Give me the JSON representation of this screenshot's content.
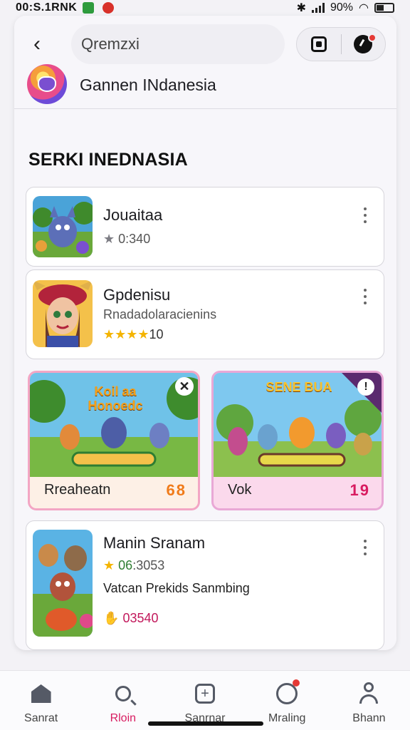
{
  "status_bar": {
    "time": "00:S.1RNK",
    "battery": "90%"
  },
  "header": {
    "search_text": "Qremzxi",
    "channel_name": "Gannen INdanesia"
  },
  "section": {
    "title": "SERKI INEDNASIA"
  },
  "list": [
    {
      "title": "Jouaitaa",
      "rating": "0:340"
    },
    {
      "title": "Gpdenisu",
      "subtitle": "Rnadadolaracienins",
      "rating": "10"
    },
    {
      "title": "Manin Sranam",
      "rating": "06",
      "rating_extra": ":3053",
      "description": "Vatcan Prekids Sanmbing",
      "likes": "03540"
    }
  ],
  "featured": [
    {
      "banner": "Koil aa Honoedc",
      "label": "Rreaheatn",
      "count": "68"
    },
    {
      "banner": "SENE BUA",
      "label": "Vok",
      "count": "19"
    }
  ],
  "bottom_nav": [
    {
      "label": "Sanrat"
    },
    {
      "label": "Rloin"
    },
    {
      "label": "Sanrnar"
    },
    {
      "label": "Mraling"
    },
    {
      "label": "Bhann"
    }
  ],
  "colors": {
    "accent": "#d81b60",
    "star": "#f4b400",
    "featured_count_1": "#f07b1a",
    "featured_count_2": "#d81b60"
  }
}
